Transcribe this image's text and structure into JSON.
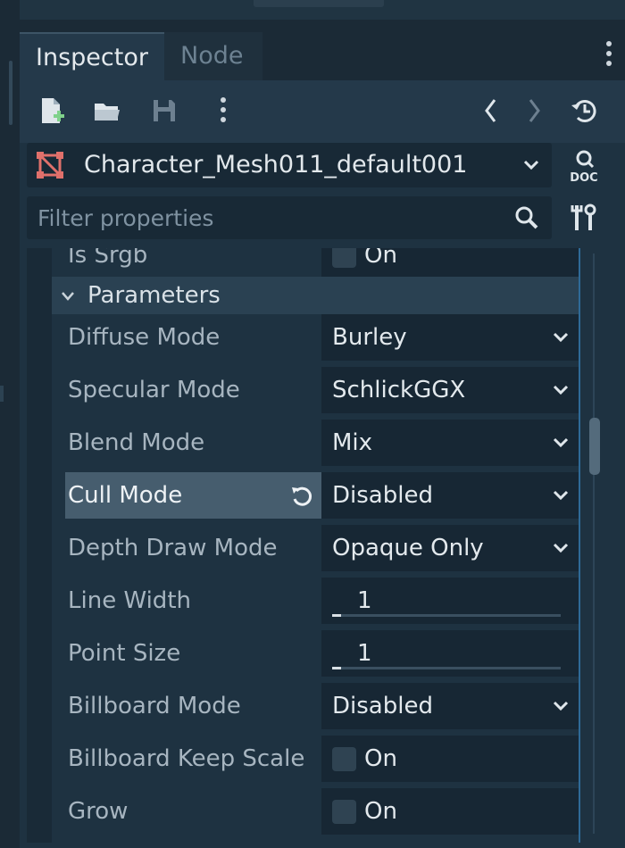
{
  "tabs": [
    {
      "label": "Inspector",
      "active": true
    },
    {
      "label": "Node",
      "active": false
    }
  ],
  "toolbar": {
    "icons": [
      "new-resource-icon",
      "open-folder-icon",
      "save-icon",
      "more-vert-icon",
      "history-back-icon",
      "history-forward-icon",
      "object-history-icon"
    ]
  },
  "resource": {
    "name": "Character_Mesh011_default001",
    "icon": "mesh-icon"
  },
  "doc_label": "DOC",
  "filter": {
    "placeholder": "Filter properties",
    "value": ""
  },
  "partial_row": {
    "label": "Is Srgb",
    "value": "On"
  },
  "section": {
    "label": "Parameters"
  },
  "properties": [
    {
      "label": "Diffuse Mode",
      "value": "Burley",
      "type": "dropdown"
    },
    {
      "label": "Specular Mode",
      "value": "SchlickGGX",
      "type": "dropdown"
    },
    {
      "label": "Blend Mode",
      "value": "Mix",
      "type": "dropdown"
    },
    {
      "label": "Cull Mode",
      "value": "Disabled",
      "type": "dropdown",
      "modified": true
    },
    {
      "label": "Depth Draw Mode",
      "value": "Opaque Only",
      "type": "dropdown"
    },
    {
      "label": "Line Width",
      "value": "1",
      "type": "slider"
    },
    {
      "label": "Point Size",
      "value": "1",
      "type": "slider"
    },
    {
      "label": "Billboard Mode",
      "value": "Disabled",
      "type": "dropdown"
    },
    {
      "label": "Billboard Keep Scale",
      "value": "On",
      "type": "checkbox"
    },
    {
      "label": "Grow",
      "value": "On",
      "type": "checkbox"
    }
  ],
  "colors": {
    "accent": "#2f6a97",
    "mesh_icon": "#e0706b",
    "add_plus": "#7fd18b"
  }
}
